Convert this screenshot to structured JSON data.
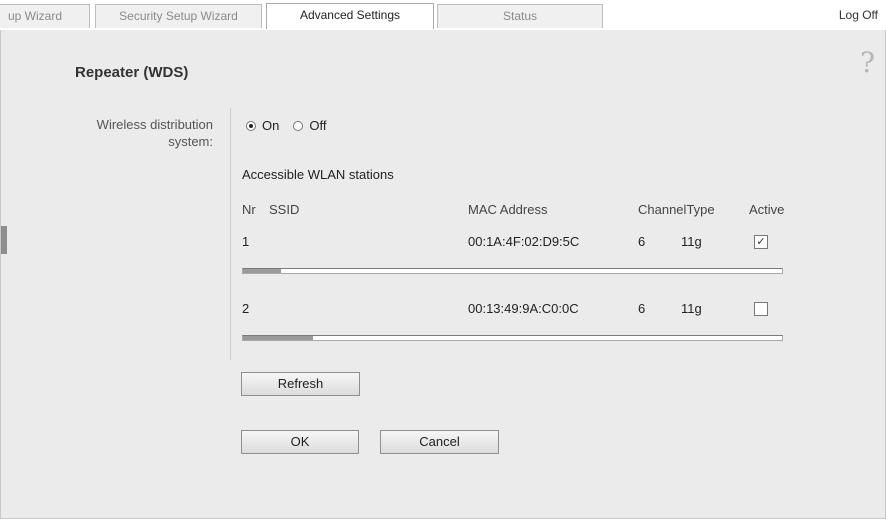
{
  "tabs": [
    {
      "label": "up Wizard",
      "active": false
    },
    {
      "label": "Security Setup Wizard",
      "active": false
    },
    {
      "label": "Advanced Settings",
      "active": true
    },
    {
      "label": "Status",
      "active": false
    }
  ],
  "header": {
    "logoff": "Log Off"
  },
  "help_icon": {
    "glyph": "?",
    "icon": "help-icon"
  },
  "page": {
    "title": "Repeater (WDS)"
  },
  "wds": {
    "label": "Wireless distribution system:",
    "options": [
      {
        "label": "On",
        "checked": true
      },
      {
        "label": "Off",
        "checked": false
      }
    ]
  },
  "stations": {
    "title": "Accessible WLAN stations",
    "headers": {
      "nr": "Nr",
      "ssid": "SSID",
      "mac": "MAC Address",
      "channel": "Channel",
      "type": "Type",
      "active": "Active"
    },
    "rows": [
      {
        "nr": "1",
        "ssid": "",
        "mac": "00:1A:4F:02:D9:5C",
        "channel": "6",
        "type": "11g",
        "active": true,
        "signal": 0.07
      },
      {
        "nr": "2",
        "ssid": "",
        "mac": "00:13:49:9A:C0:0C",
        "channel": "6",
        "type": "11g",
        "active": false,
        "signal": 0.13
      }
    ]
  },
  "buttons": {
    "refresh": "Refresh",
    "ok": "OK",
    "cancel": "Cancel"
  }
}
